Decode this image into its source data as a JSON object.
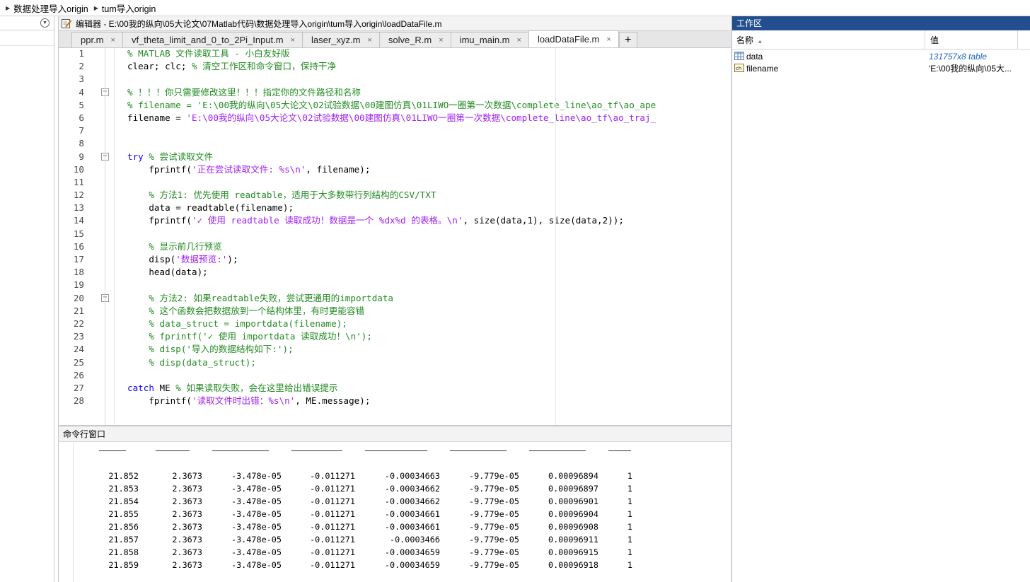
{
  "breadcrumb": [
    "数据处理导入origin",
    "tum导入origin"
  ],
  "editor": {
    "title": "编辑器 - E:\\00我的纵向\\05大论文\\07Matlab代码\\数据处理导入origin\\tum导入origin\\loadDataFile.m",
    "tabs": [
      {
        "label": "ppr.m",
        "active": false
      },
      {
        "label": "vf_theta_limit_and_0_to_2Pi_Input.m",
        "active": false
      },
      {
        "label": "laser_xyz.m",
        "active": false
      },
      {
        "label": "solve_R.m",
        "active": false
      },
      {
        "label": "imu_main.m",
        "active": false
      },
      {
        "label": "loadDataFile.m",
        "active": true
      }
    ],
    "add_tab": "+",
    "close_glyph": "×",
    "lines": [
      {
        "n": "1",
        "fold": "",
        "segs": [
          [
            "cm",
            "% MATLAB 文件读取工具 - 小白友好版"
          ]
        ]
      },
      {
        "n": "2",
        "fold": "",
        "segs": [
          [
            "",
            "clear; clc; "
          ],
          [
            "cm",
            "% 清空工作区和命令窗口，保持干净"
          ]
        ]
      },
      {
        "n": "3",
        "fold": "",
        "segs": []
      },
      {
        "n": "4",
        "fold": "−",
        "segs": [
          [
            "cm",
            "% ！！！你只需要修改这里！！！指定你的文件路径和名称"
          ]
        ]
      },
      {
        "n": "5",
        "fold": "",
        "segs": [
          [
            "cm",
            "% filename = 'E:\\00我的纵向\\05大论文\\02试验数据\\00建图仿真\\01LIWO一圈第一次数据\\complete_line\\ao_tf\\ao_ape"
          ]
        ]
      },
      {
        "n": "6",
        "fold": "",
        "segs": [
          [
            "",
            "filename = "
          ],
          [
            "str",
            "'E:\\00我的纵向\\05大论文\\02试验数据\\00建图仿真\\01LIWO一圈第一次数据\\complete_line\\ao_tf\\ao_traj_"
          ]
        ]
      },
      {
        "n": "7",
        "fold": "",
        "segs": []
      },
      {
        "n": "8",
        "fold": "",
        "segs": []
      },
      {
        "n": "9",
        "fold": "−",
        "segs": [
          [
            "kw",
            "try"
          ],
          [
            "",
            " "
          ],
          [
            "cm",
            "% 尝试读取文件"
          ]
        ]
      },
      {
        "n": "10",
        "fold": "",
        "segs": [
          [
            "",
            "    fprintf("
          ],
          [
            "str",
            "'正在尝试读取文件: %s\\n'"
          ],
          [
            "",
            ", filename);"
          ]
        ]
      },
      {
        "n": "11",
        "fold": "",
        "segs": []
      },
      {
        "n": "12",
        "fold": "",
        "segs": [
          [
            "cm",
            "    % 方法1: 优先使用 readtable，适用于大多数带行列结构的CSV/TXT"
          ]
        ]
      },
      {
        "n": "13",
        "fold": "",
        "segs": [
          [
            "",
            "    data = readtable(filename);"
          ]
        ]
      },
      {
        "n": "14",
        "fold": "",
        "segs": [
          [
            "",
            "    fprintf("
          ],
          [
            "str",
            "'✓ 使用 readtable 读取成功！数据是一个 %dx%d 的表格。\\n'"
          ],
          [
            "",
            ", size(data,1), size(data,2));"
          ]
        ]
      },
      {
        "n": "15",
        "fold": "",
        "segs": []
      },
      {
        "n": "16",
        "fold": "",
        "segs": [
          [
            "cm",
            "    % 显示前几行预览"
          ]
        ]
      },
      {
        "n": "17",
        "fold": "",
        "segs": [
          [
            "",
            "    disp("
          ],
          [
            "str",
            "'数据预览:'"
          ],
          [
            "",
            ");"
          ]
        ]
      },
      {
        "n": "18",
        "fold": "",
        "segs": [
          [
            "",
            "    head(data);"
          ]
        ]
      },
      {
        "n": "19",
        "fold": "",
        "segs": []
      },
      {
        "n": "20",
        "fold": "−",
        "segs": [
          [
            "cm",
            "    % 方法2: 如果readtable失败，尝试更通用的importdata"
          ]
        ]
      },
      {
        "n": "21",
        "fold": "",
        "segs": [
          [
            "cm",
            "    % 这个函数会把数据放到一个结构体里，有时更能容错"
          ]
        ]
      },
      {
        "n": "22",
        "fold": "",
        "segs": [
          [
            "cm",
            "    % data_struct = importdata(filename);"
          ]
        ]
      },
      {
        "n": "23",
        "fold": "",
        "segs": [
          [
            "cm",
            "    % fprintf('✓ 使用 importdata 读取成功！\\n');"
          ]
        ]
      },
      {
        "n": "24",
        "fold": "",
        "segs": [
          [
            "cm",
            "    % disp('导入的数据结构如下:');"
          ]
        ]
      },
      {
        "n": "25",
        "fold": "",
        "segs": [
          [
            "cm",
            "    % disp(data_struct);"
          ]
        ]
      },
      {
        "n": "26",
        "fold": "",
        "segs": []
      },
      {
        "n": "27",
        "fold": "",
        "segs": [
          [
            "kw",
            "catch"
          ],
          [
            "",
            " ME "
          ],
          [
            "cm",
            "% 如果读取失败，会在这里给出错误提示"
          ]
        ]
      },
      {
        "n": "28",
        "fold": "",
        "segs": [
          [
            "",
            "    fprintf("
          ],
          [
            "str",
            "'读取文件时出错：%s\\n'"
          ],
          [
            "",
            ", ME.message);"
          ]
        ]
      }
    ]
  },
  "command_window": {
    "title": "命令行窗口",
    "rows": [
      [
        "21.852",
        "2.3673",
        "-3.478e-05",
        "-0.011271",
        "-0.00034663",
        "-9.779e-05",
        "0.00096894",
        "1"
      ],
      [
        "21.853",
        "2.3673",
        "-3.478e-05",
        "-0.011271",
        "-0.00034662",
        "-9.779e-05",
        "0.00096897",
        "1"
      ],
      [
        "21.854",
        "2.3673",
        "-3.478e-05",
        "-0.011271",
        "-0.00034662",
        "-9.779e-05",
        "0.00096901",
        "1"
      ],
      [
        "21.855",
        "2.3673",
        "-3.478e-05",
        "-0.011271",
        "-0.00034661",
        "-9.779e-05",
        "0.00096904",
        "1"
      ],
      [
        "21.856",
        "2.3673",
        "-3.478e-05",
        "-0.011271",
        "-0.00034661",
        "-9.779e-05",
        "0.00096908",
        "1"
      ],
      [
        "21.857",
        "2.3673",
        "-3.478e-05",
        "-0.011271",
        "-0.0003466",
        "-9.779e-05",
        "0.00096911",
        "1"
      ],
      [
        "21.858",
        "2.3673",
        "-3.478e-05",
        "-0.011271",
        "-0.00034659",
        "-9.779e-05",
        "0.00096915",
        "1"
      ],
      [
        "21.859",
        "2.3673",
        "-3.478e-05",
        "-0.011271",
        "-0.00034659",
        "-9.779e-05",
        "0.00096918",
        "1"
      ]
    ]
  },
  "workspace": {
    "title": "工作区",
    "col_name": "名称",
    "sort_glyph": "▲",
    "col_value": "值",
    "vars": [
      {
        "name": "data",
        "value": "131757x8 table",
        "kind": "table"
      },
      {
        "name": "filename",
        "value": "'E:\\00我的纵向\\05大...",
        "kind": "char"
      }
    ]
  },
  "colors": {
    "keyword": "#0E00FF",
    "comment": "#228B22",
    "string": "#A020F0",
    "workspace_title_bg": "#244F8E"
  }
}
